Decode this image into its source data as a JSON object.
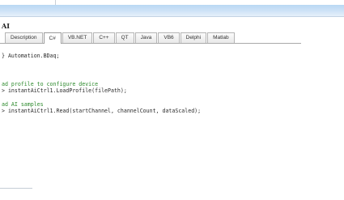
{
  "panel": {
    "title": "AI"
  },
  "tabs": [
    {
      "label": "Description",
      "active": false
    },
    {
      "label": "C#",
      "active": true
    },
    {
      "label": "VB.NET",
      "active": false
    },
    {
      "label": "C++",
      "active": false
    },
    {
      "label": "QT",
      "active": false
    },
    {
      "label": "Java",
      "active": false
    },
    {
      "label": "VB6",
      "active": false
    },
    {
      "label": "Delphi",
      "active": false
    },
    {
      "label": "Matlab",
      "active": false
    }
  ],
  "code": {
    "using_line": "} Automation.BDaq;",
    "comment_profile": "ad profile to configure device",
    "load_profile_line": "> instantAiCtrl1.LoadProfile(filePath);",
    "comment_read": "ad AI samples",
    "read_line": "> instantAiCtrl1.Read(startChannel, channelCount, dataScaled);"
  },
  "colors": {
    "titlebar": "#cfe3f7",
    "comment": "#2d8a2d",
    "code_text": "#2a2a2a"
  }
}
